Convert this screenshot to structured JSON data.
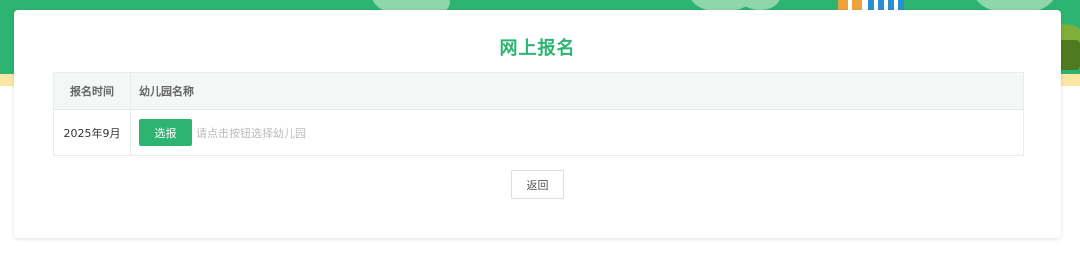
{
  "page": {
    "title": "网上报名"
  },
  "table": {
    "headers": [
      "报名时间",
      "幼儿园名称"
    ],
    "rows": [
      {
        "date": "2025年9月",
        "select_label": "选报",
        "hint": "请点击按钮选择幼儿园"
      }
    ]
  },
  "actions": {
    "back_label": "返回"
  },
  "colors": {
    "accent": "#2db472",
    "banner": "#2db472",
    "hint_text": "#bbbbbb"
  }
}
